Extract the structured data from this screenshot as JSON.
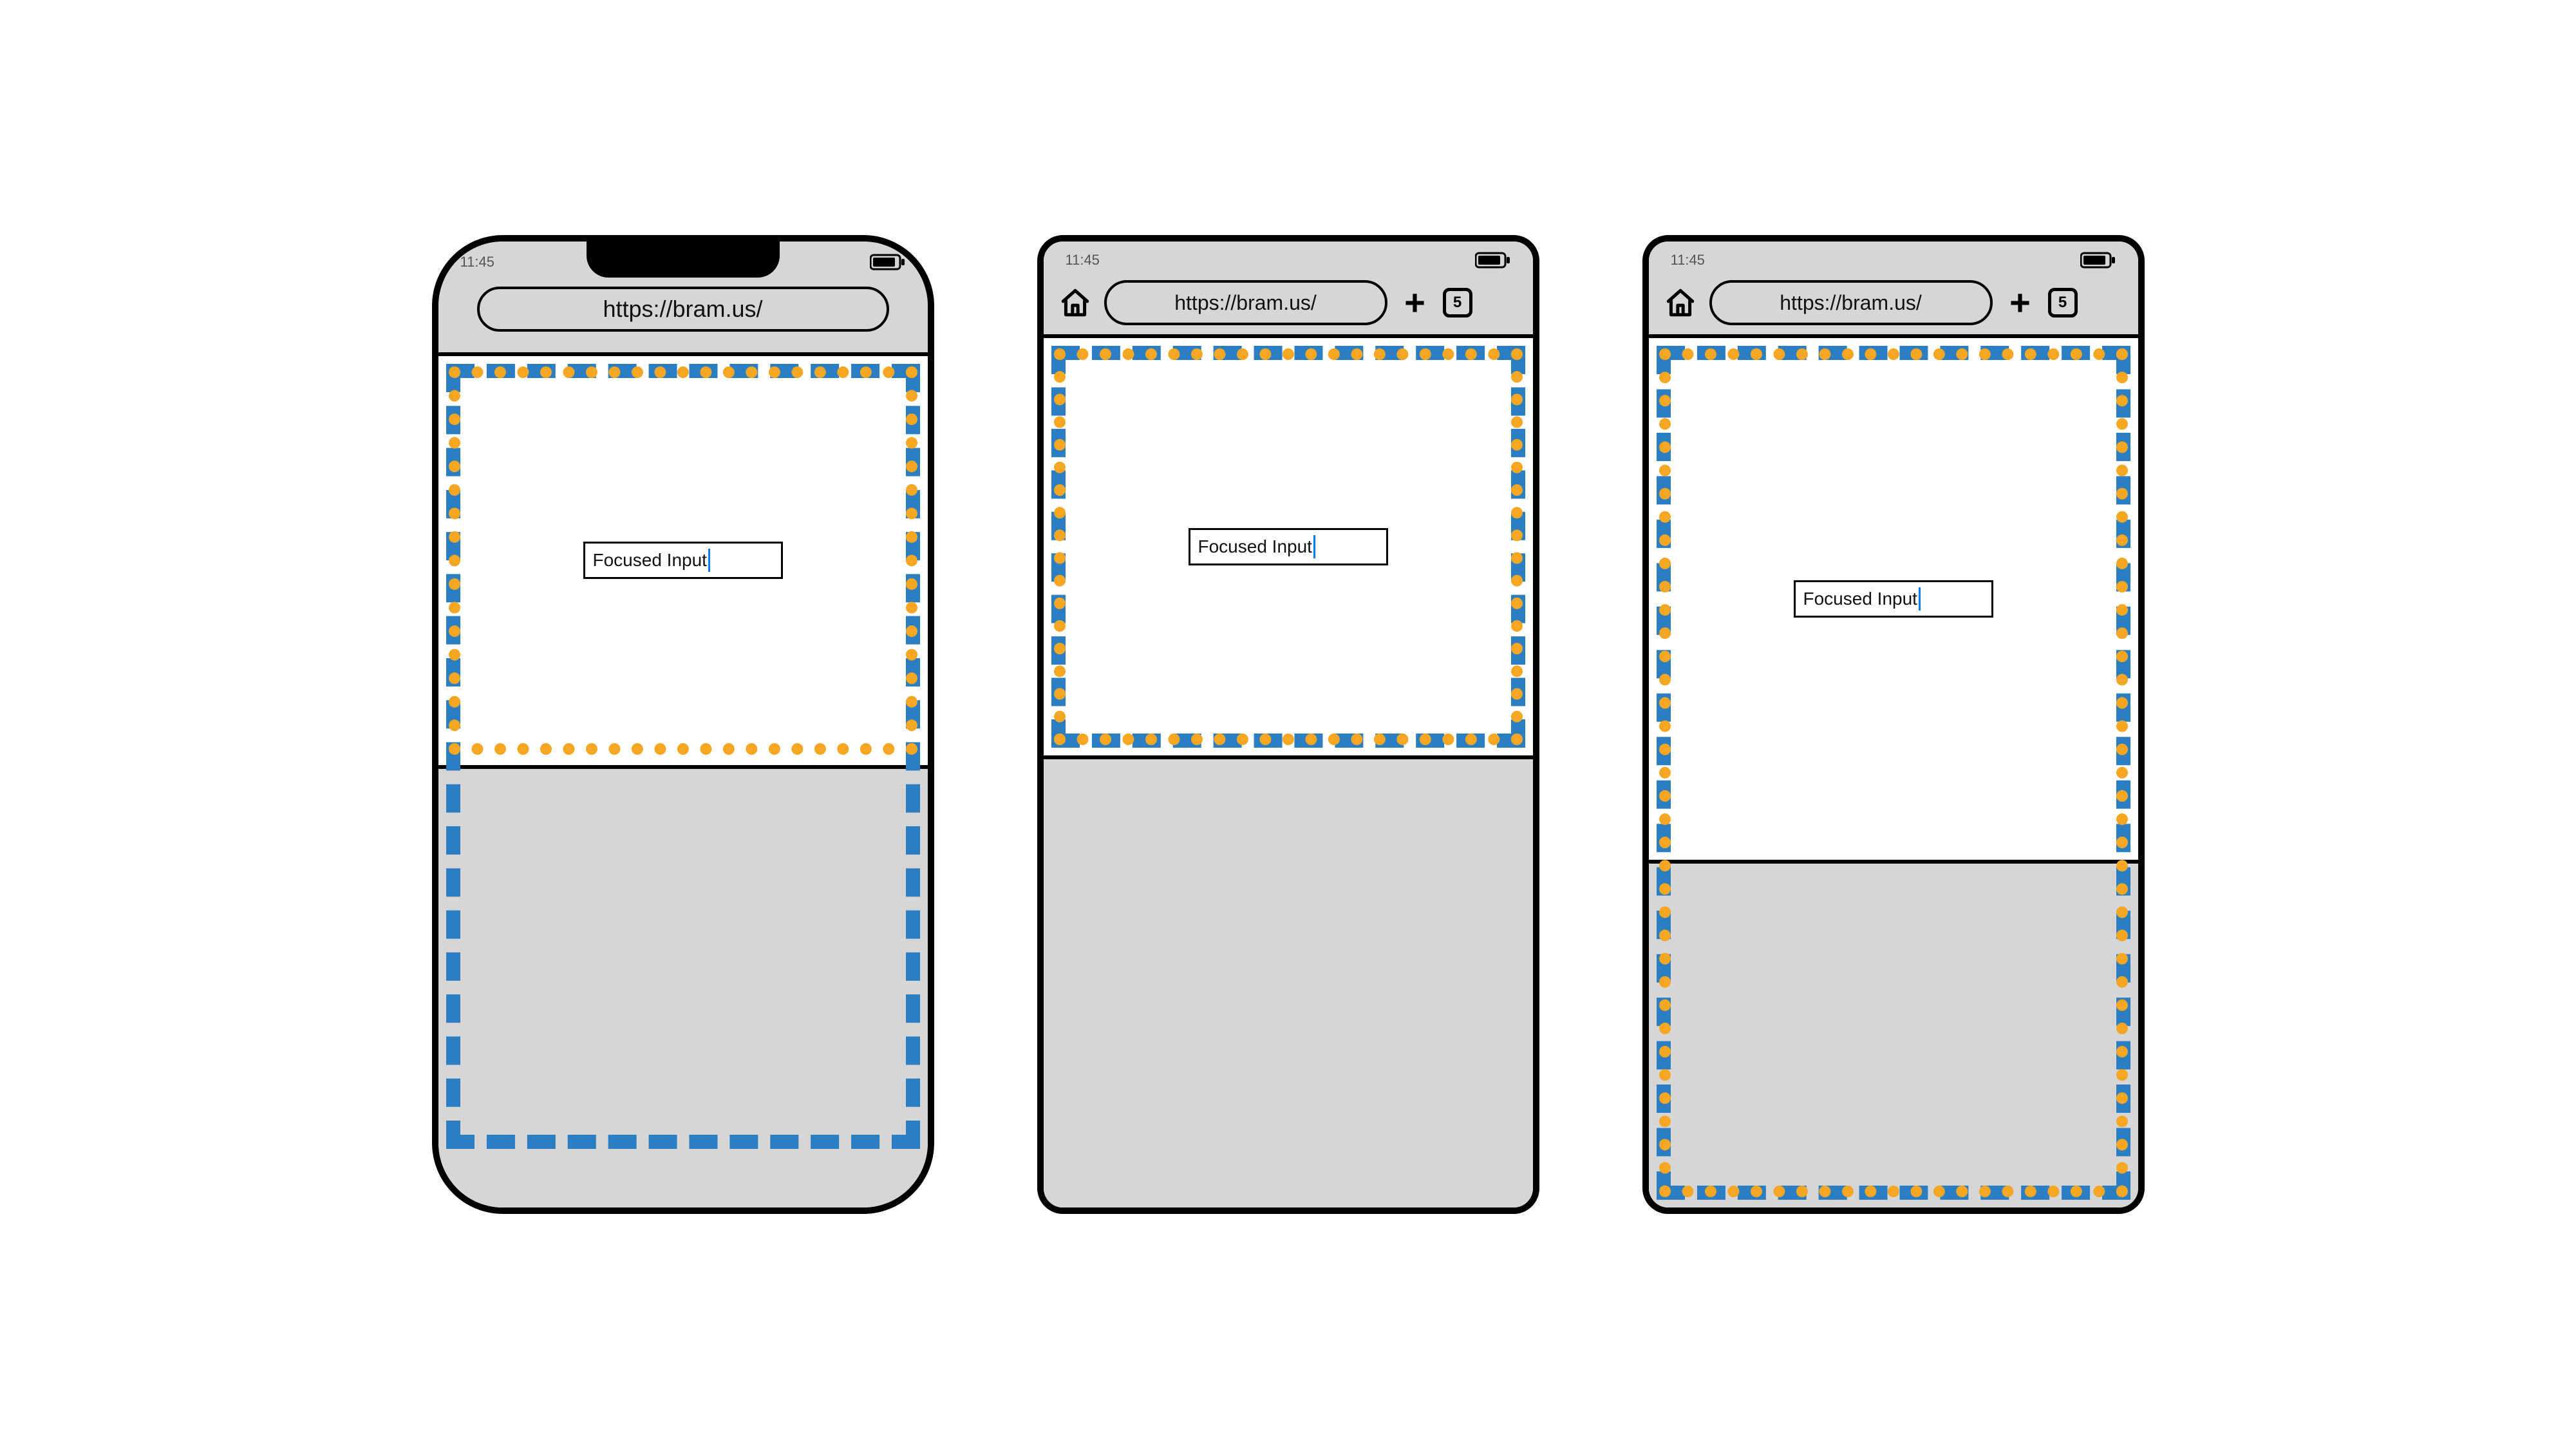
{
  "common": {
    "time": "11:45",
    "url": "https://bram.us/",
    "tab_count": "5",
    "input_value": "Focused Input"
  },
  "devices": [
    {
      "kind": "iphone",
      "webpage_bottom_pct": 52,
      "blue_bottom_pct": 6,
      "orange_bottom_pct": 52
    },
    {
      "kind": "android",
      "webpage_bottom_pct": 52,
      "blue_bottom_pct": 52,
      "orange_bottom_pct": 52
    },
    {
      "kind": "android",
      "webpage_bottom_pct": 40,
      "blue_bottom_pct": 0,
      "orange_bottom_pct": 0
    }
  ]
}
